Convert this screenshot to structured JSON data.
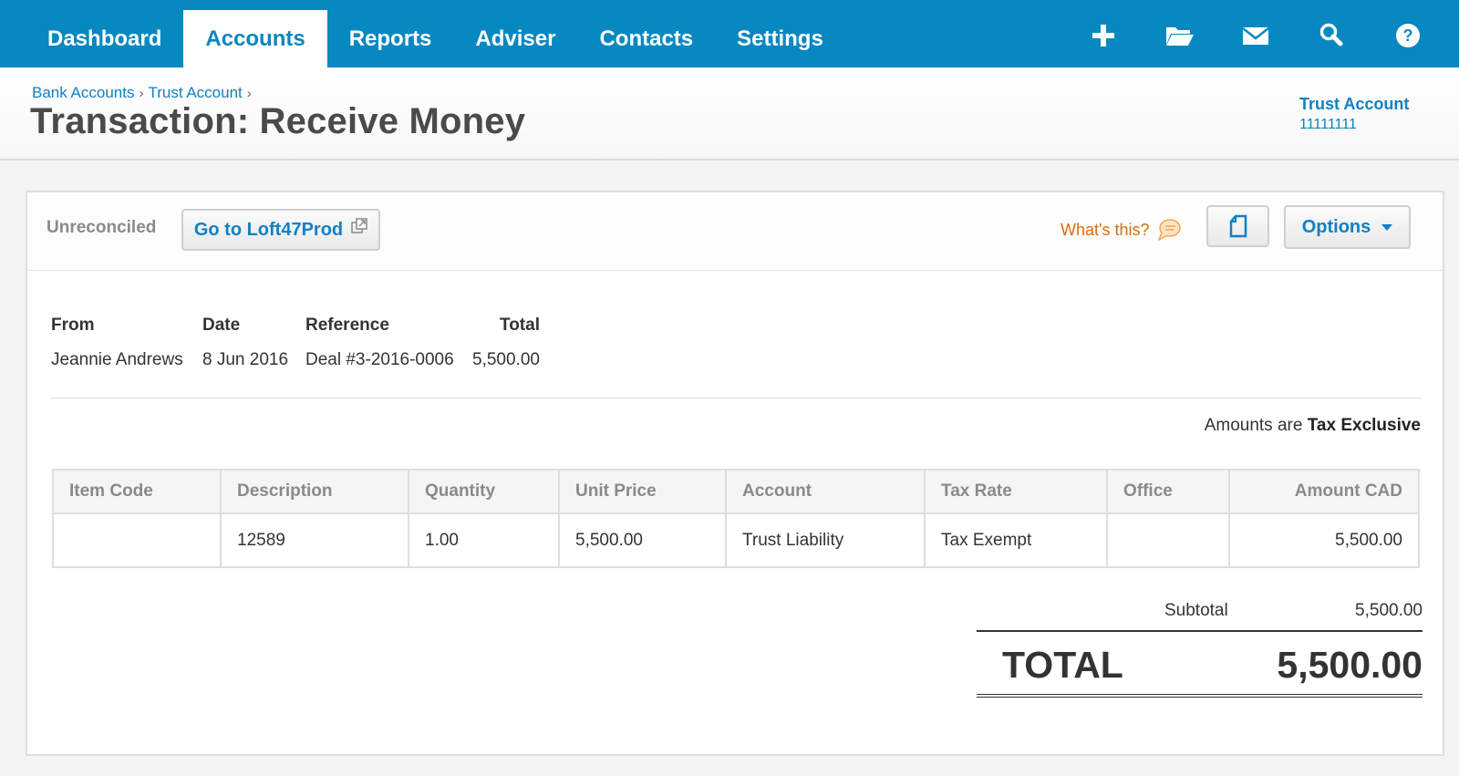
{
  "nav": {
    "tabs": [
      {
        "label": "Dashboard"
      },
      {
        "label": "Accounts"
      },
      {
        "label": "Reports"
      },
      {
        "label": "Adviser"
      },
      {
        "label": "Contacts"
      },
      {
        "label": "Settings"
      }
    ],
    "active_tab": "Accounts",
    "icons": [
      "plus-icon",
      "folder-icon",
      "mail-icon",
      "search-icon",
      "help-icon"
    ]
  },
  "header": {
    "breadcrumb": [
      "Bank Accounts",
      "Trust Account"
    ],
    "breadcrumb_sep": "›",
    "title": "Transaction: Receive Money",
    "account_name": "Trust Account",
    "account_number": "11111111"
  },
  "toolbar": {
    "status": "Unreconciled",
    "goto_label": "Go to Loft47Prod",
    "whats_this": "What's this?",
    "options_label": "Options"
  },
  "summary": {
    "headers": {
      "from": "From",
      "date": "Date",
      "reference": "Reference",
      "total": "Total"
    },
    "from": "Jeannie Andrews",
    "date": "8 Jun 2016",
    "reference": "Deal #3-2016-0006",
    "total": "5,500.00"
  },
  "tax_note": {
    "prefix": "Amounts are",
    "mode": "Tax Exclusive"
  },
  "items": {
    "columns": [
      "Item Code",
      "Description",
      "Quantity",
      "Unit Price",
      "Account",
      "Tax Rate",
      "Office",
      "Amount CAD"
    ],
    "rows": [
      {
        "item_code": "",
        "description": "12589",
        "quantity": "1.00",
        "unit_price": "5,500.00",
        "account": "Trust Liability",
        "tax_rate": "Tax Exempt",
        "office": "",
        "amount": "5,500.00"
      }
    ]
  },
  "totals": {
    "subtotal_label": "Subtotal",
    "subtotal": "5,500.00",
    "total_label": "TOTAL",
    "total": "5,500.00"
  },
  "colors": {
    "nav_bg": "#0888c1",
    "link": "#1180c4",
    "whats_this": "#d96d0e"
  }
}
